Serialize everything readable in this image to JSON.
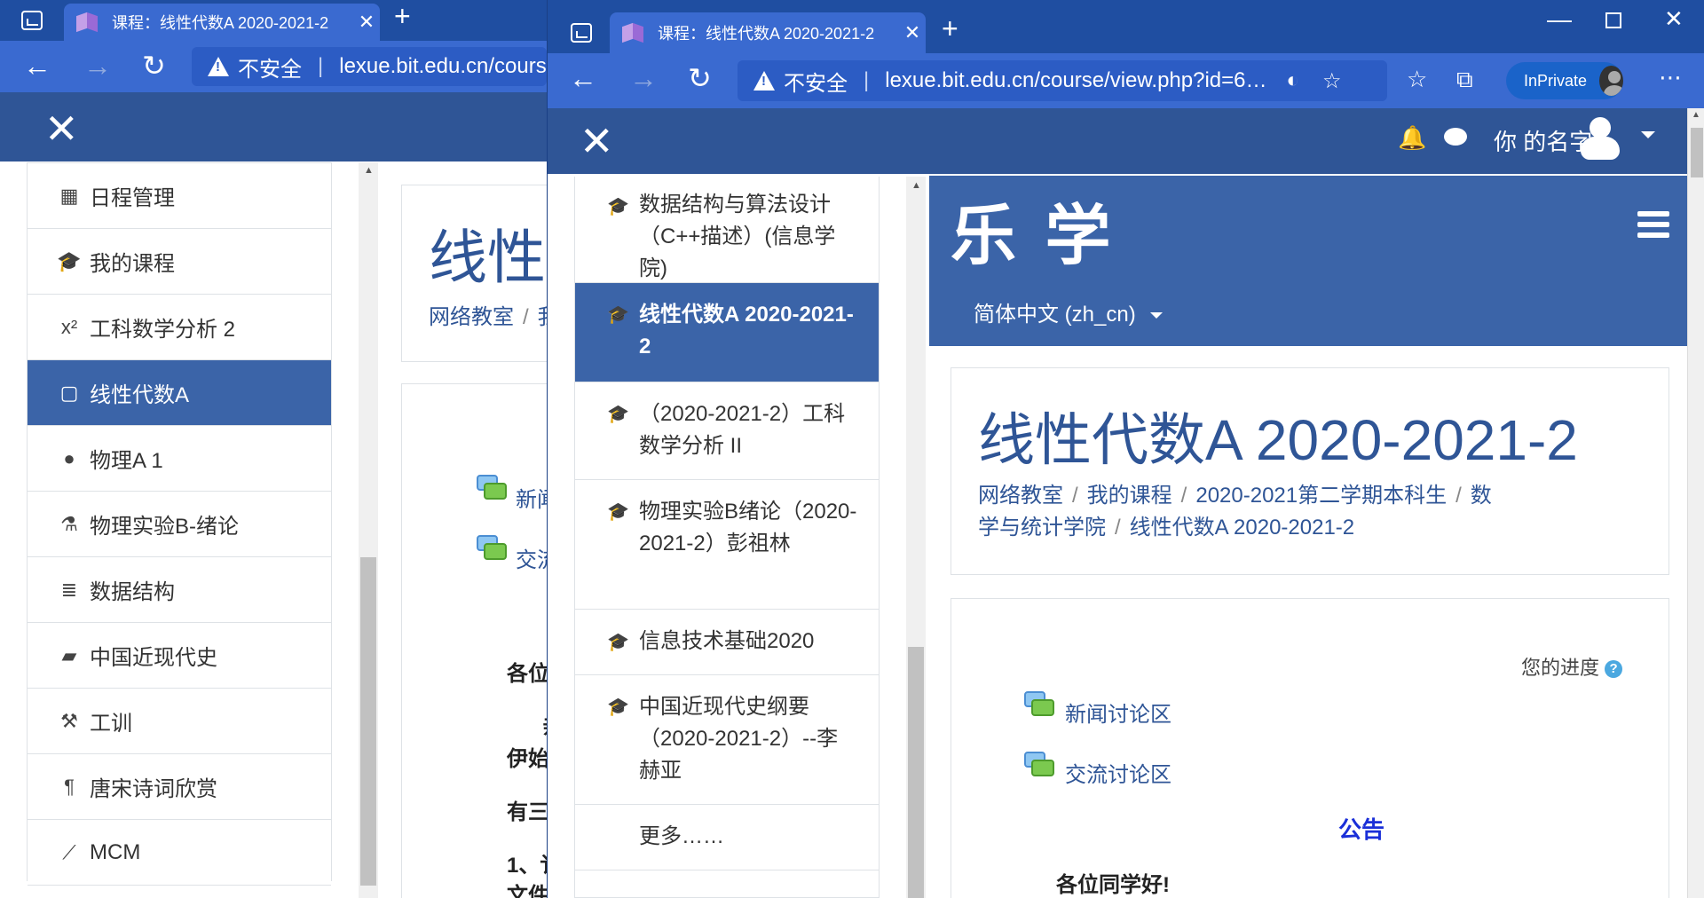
{
  "back_window": {
    "tab_title": "课程：线性代数A 2020-2021-2",
    "address_warning": "不安全",
    "address_url": "lexue.bit.edu.cn/course/view.php?id=6…",
    "drawer_items": [
      {
        "icon": "calendar-icon",
        "glyph": "▦",
        "label": "日程管理",
        "active": false
      },
      {
        "icon": "graduation-cap-icon",
        "glyph": "🎓",
        "label": "我的课程",
        "active": false
      },
      {
        "icon": "superscript-icon",
        "glyph": "x²",
        "label": "工科数学分析 2",
        "active": false
      },
      {
        "icon": "square-icon",
        "glyph": "▢",
        "label": "线性代数A",
        "active": true
      },
      {
        "icon": "globe-icon",
        "glyph": "●",
        "label": "物理A 1",
        "active": false
      },
      {
        "icon": "flask-icon",
        "glyph": "⚗",
        "label": "物理实验B-绪论",
        "active": false
      },
      {
        "icon": "database-icon",
        "glyph": "≣",
        "label": "数据结构",
        "active": false
      },
      {
        "icon": "book-icon",
        "glyph": "▰",
        "label": "中国近现代史",
        "active": false
      },
      {
        "icon": "wrench-icon",
        "glyph": "⚒",
        "label": "工训",
        "active": false
      },
      {
        "icon": "paragraph-icon",
        "glyph": "¶",
        "label": "唐宋诗词欣赏",
        "active": false
      },
      {
        "icon": "line-chart-icon",
        "glyph": "⟋",
        "label": "MCM",
        "active": false
      }
    ],
    "page_title_partial": "线性代",
    "breadcrumb_partial": "网络教室",
    "breadcrumb_sep": "/",
    "breadcrumb_next_partial": "我",
    "forum1_partial": "新闻",
    "forum2_partial": "交流",
    "text_fragments": [
      "各位",
      "亲",
      "伊始",
      "有三",
      "1、讠",
      "文件"
    ]
  },
  "front_window": {
    "tab_title": "课程：线性代数A 2020-2021-2",
    "address_warning": "不安全",
    "address_url": "lexue.bit.edu.cn/course/view.php?id=6…",
    "inprivate_label": "InPrivate",
    "user_name": "你 的名字",
    "course_list": [
      {
        "label": "数据结构与算法设计（C++描述）(信息学院)",
        "active": false
      },
      {
        "label": "线性代数A 2020-2021-2",
        "active": true
      },
      {
        "label": "（2020-2021-2）工科数学分析 II",
        "active": false
      },
      {
        "label": "物理实验B绪论（2020-2021-2）彭祖林",
        "active": false
      },
      {
        "label": "信息技术基础2020",
        "active": false
      },
      {
        "label": "中国近现代史纲要（2020-2021-2）--李赫亚",
        "active": false
      },
      {
        "label": "更多……",
        "active": false
      }
    ],
    "site_name": "乐 学",
    "language": "简体中文 (zh_cn)",
    "page_title": "线性代数A 2020-2021-2",
    "breadcrumb": [
      "网络教室",
      "我的课程",
      "2020-2021第二学期本科生",
      "数学与统计学院",
      "线性代数A 2020-2021-2"
    ],
    "breadcrumb_sep": "/",
    "progress_label": "您的进度",
    "forums": [
      "新闻讨论区",
      "交流讨论区"
    ],
    "announcement_title": "公告",
    "greeting": "各位同学好!"
  },
  "colors": {
    "chrome_dark": "#1f4ea1",
    "chrome": "#3a6ad0",
    "moodle_header": "#2f5596",
    "moodle_active": "#3b64a8",
    "link": "#2f5596",
    "announcement": "#1a2fd8"
  }
}
